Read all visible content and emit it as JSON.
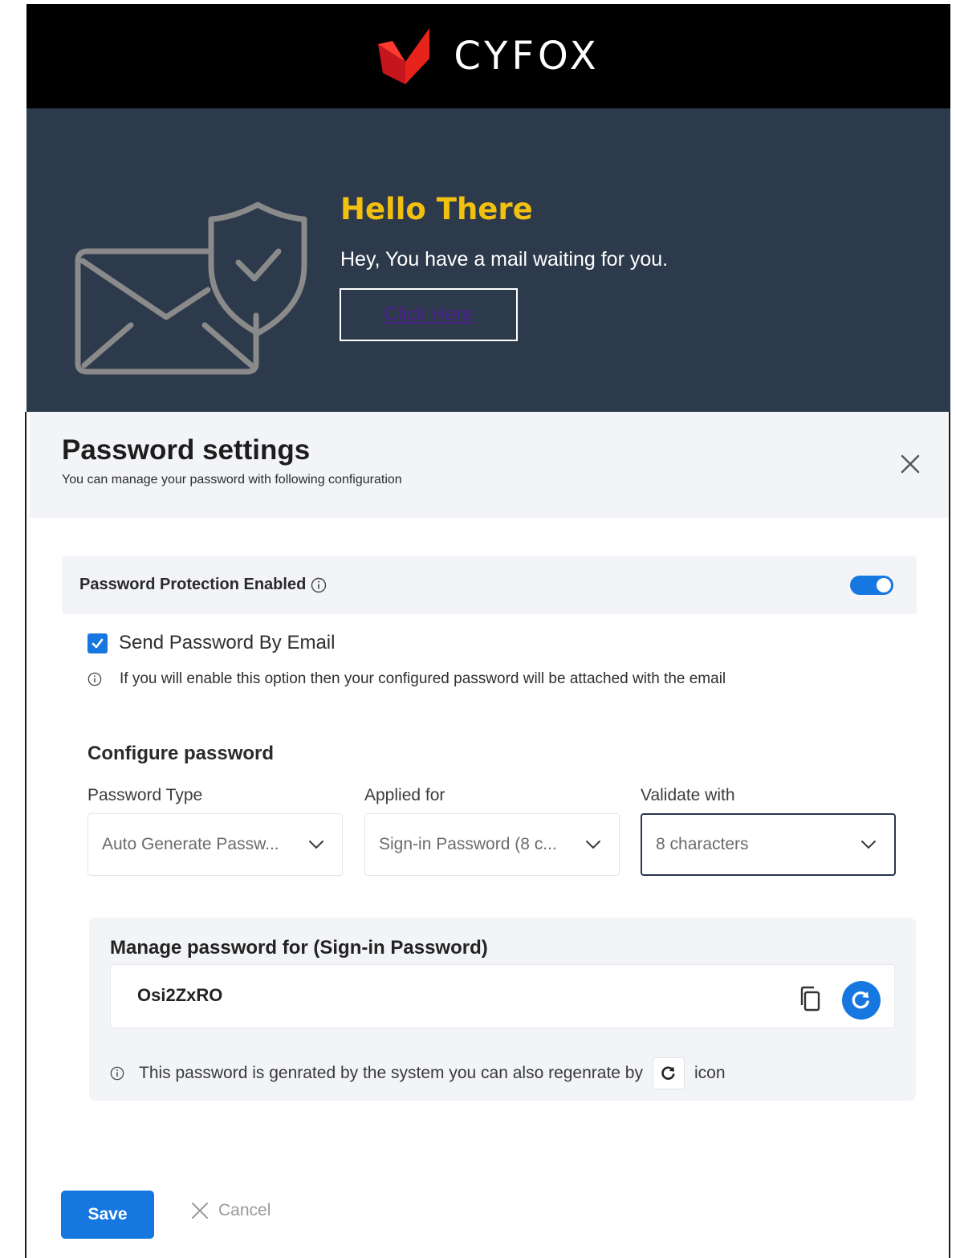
{
  "brand": {
    "name": "CYFOX",
    "colors": {
      "logo_red": "#e8231c",
      "bar_bg": "#000000"
    }
  },
  "hero": {
    "title": "Hello There",
    "message": "Hey, You have a mail waiting for you.",
    "button_label": "Click Here",
    "colors": {
      "bg": "#2d3a4b",
      "title": "#f2c00f",
      "art": "#8a8a8a"
    }
  },
  "dialog": {
    "title": "Password settings",
    "subtitle": "You can manage your password with following configuration",
    "close_icon": "close-icon",
    "protection": {
      "label": "Password Protection Enabled",
      "enabled": true,
      "accent": "#1677e0"
    },
    "send_email": {
      "label": "Send Password By Email",
      "checked": true,
      "hint": "If you will enable this option then your configured password will be attached with the email"
    },
    "configure": {
      "title": "Configure password",
      "fields": [
        {
          "label": "Password Type",
          "value": "Auto Generate Passw..."
        },
        {
          "label": "Applied for",
          "value": "Sign-in Password (8 c..."
        },
        {
          "label": "Validate with",
          "value": "8 characters"
        }
      ]
    },
    "manage": {
      "title": "Manage password for (Sign-in Password)",
      "password": "Osi2ZxRO",
      "hint_before": "This password is genrated by the system you can also regenrate by",
      "hint_after": "icon"
    },
    "actions": {
      "save_label": "Save",
      "cancel_label": "Cancel"
    }
  }
}
